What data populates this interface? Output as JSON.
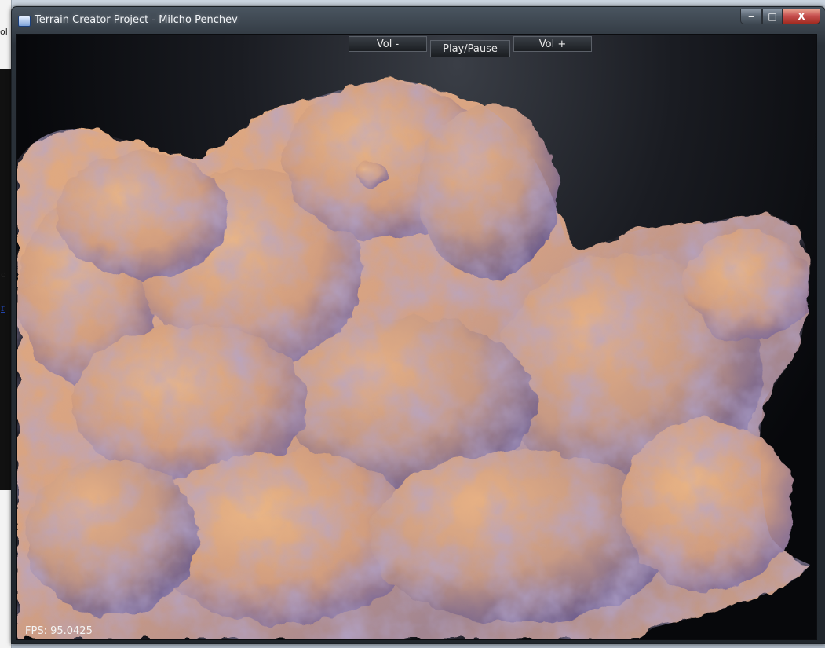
{
  "window": {
    "title": "Terrain Creator Project - Milcho Penchev",
    "caption_buttons": {
      "minimize": "‒",
      "maximize": "□",
      "close": "X"
    }
  },
  "desktop_fragments": {
    "frag1": "ol",
    "frag2": "o",
    "frag3": "r"
  },
  "controls": {
    "vol_minus": "Vol -",
    "play_pause": "Play/Pause",
    "vol_plus": "Vol +"
  },
  "hud": {
    "fps_label": "FPS:",
    "fps_value": "95.0425"
  },
  "colors": {
    "terrain_light": "#e8b083",
    "terrain_mid": "#c9997d",
    "terrain_shadow": "#7d6a9a",
    "background": "#07080b"
  }
}
